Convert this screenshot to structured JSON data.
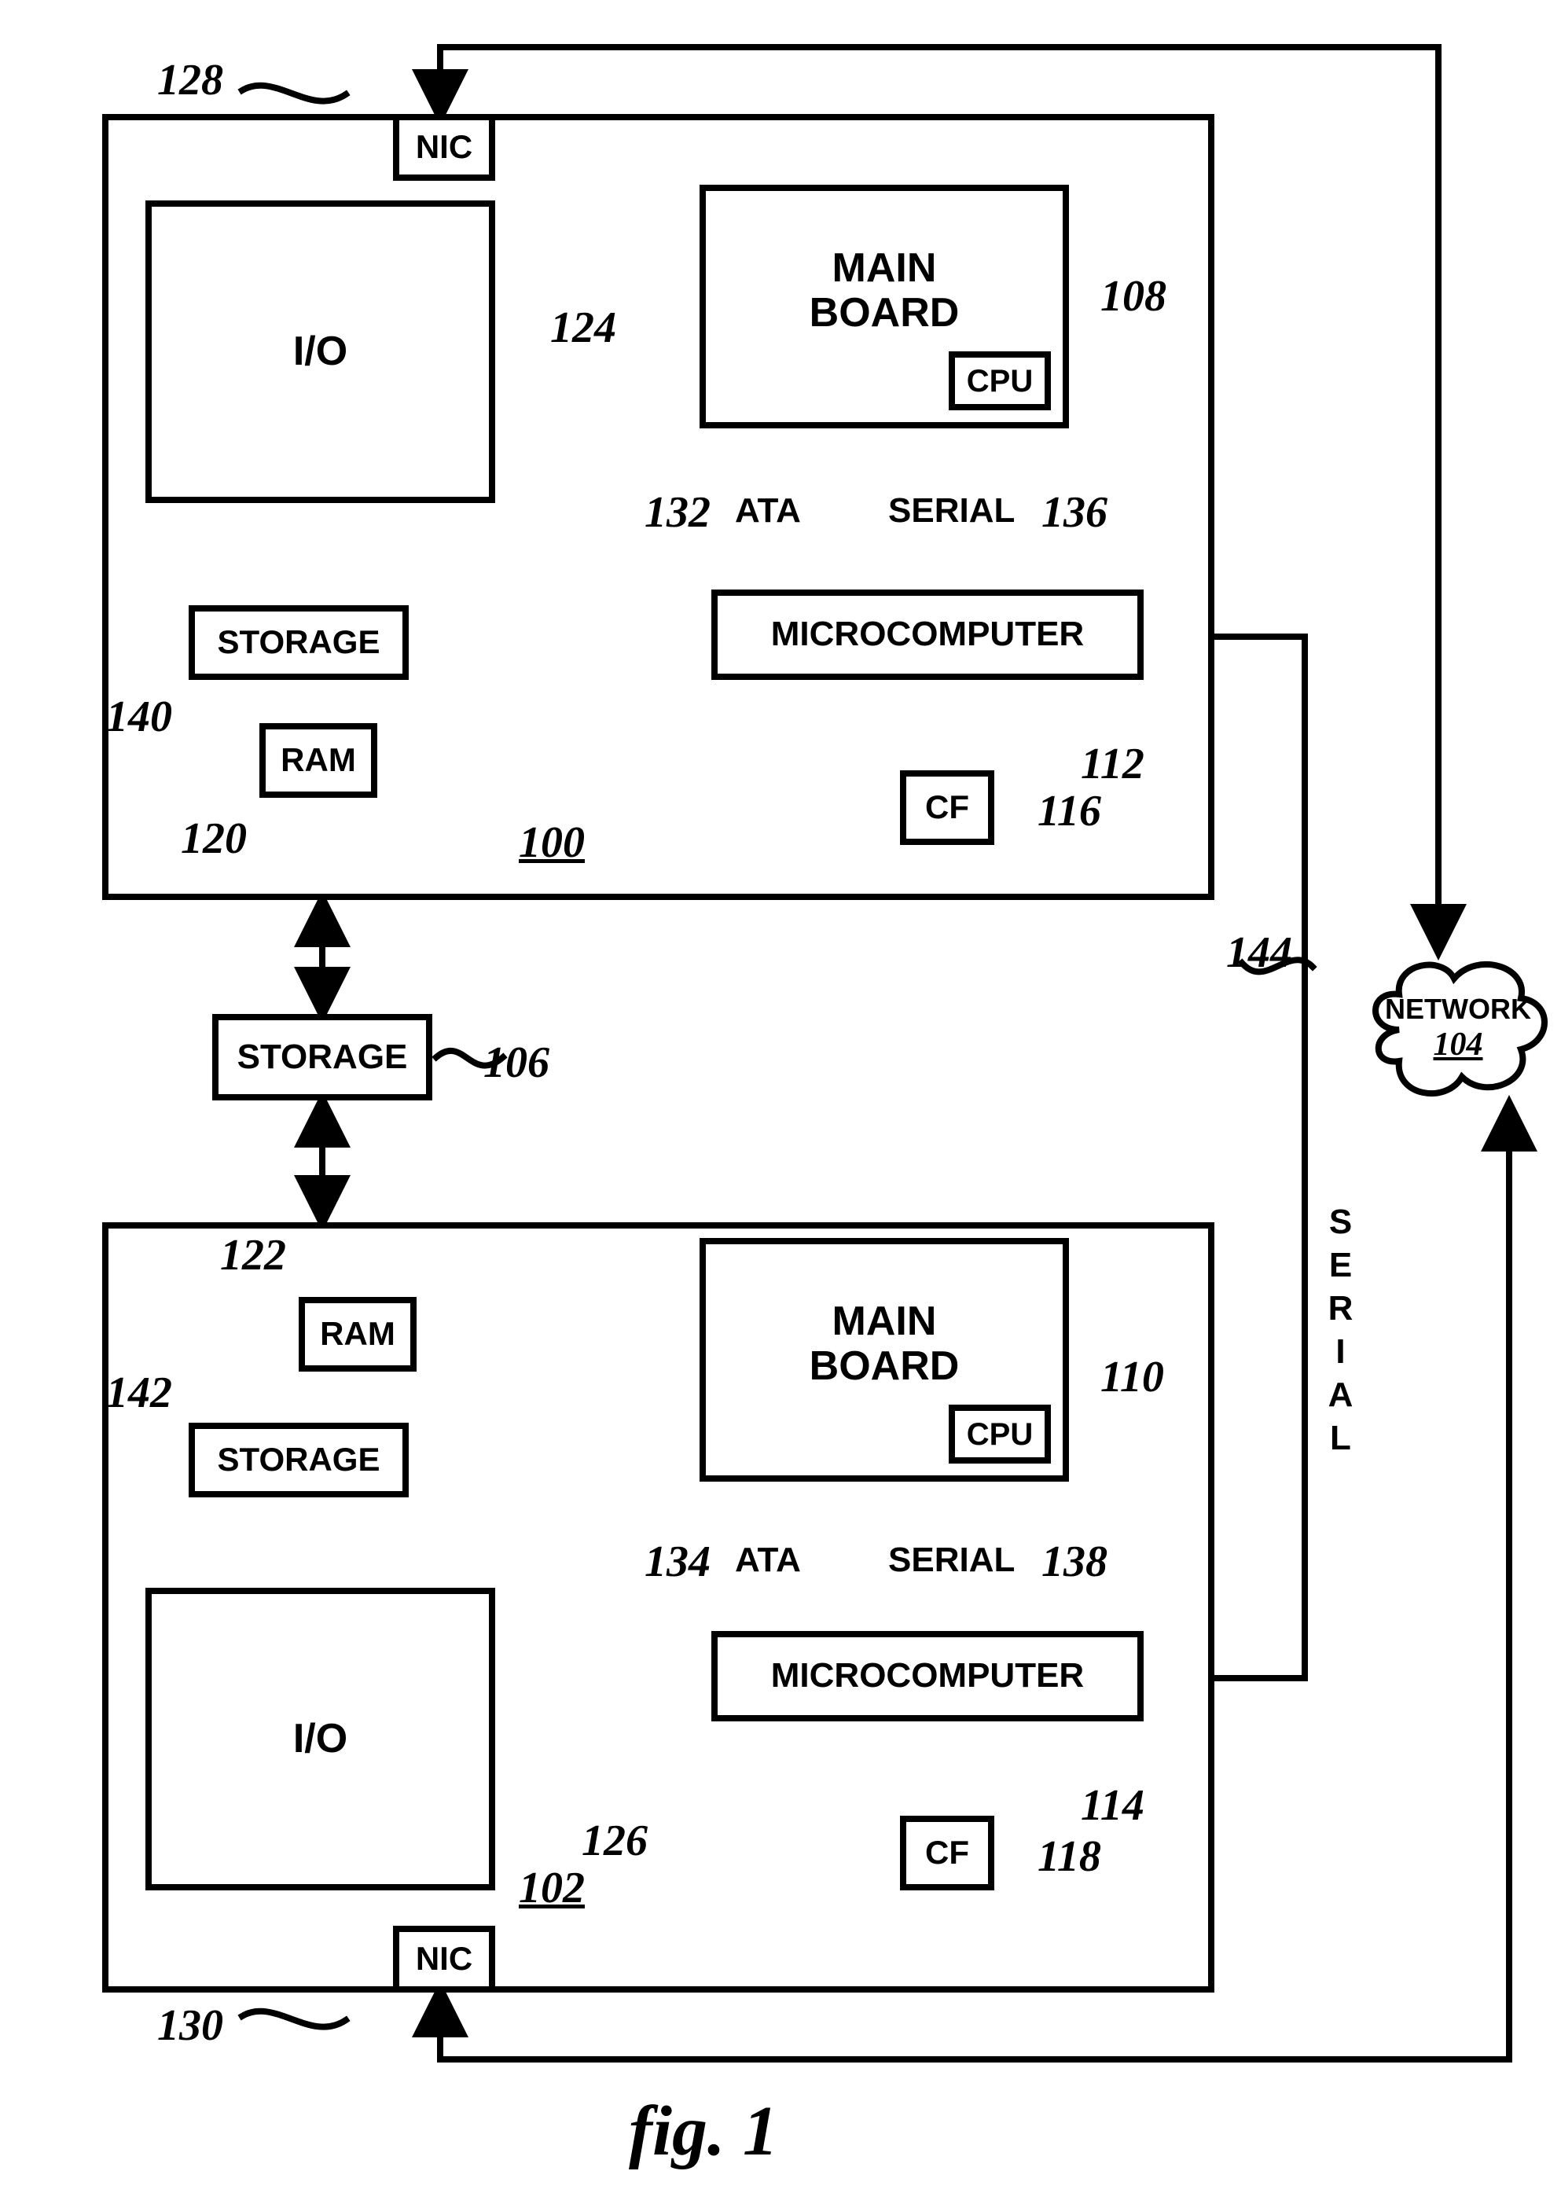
{
  "figure_caption": "fig. 1",
  "network_label": "NETWORK",
  "network_ref": "104",
  "shared_storage": {
    "label": "STORAGE",
    "ref": "106"
  },
  "serial_vertical_label": "SERIAL",
  "serial_ref": "144",
  "unit_top": {
    "id_ref": "100",
    "io": {
      "label": "I/O"
    },
    "nic": {
      "label": "NIC",
      "ref": "128"
    },
    "storage": {
      "label": "STORAGE",
      "ref": "140"
    },
    "ram": {
      "label": "RAM",
      "ref": "120"
    },
    "mainboard": {
      "label": "MAIN\nBOARD",
      "ref": "108",
      "cpu_label": "CPU"
    },
    "micro": {
      "label": "MICROCOMPUTER",
      "ref": "112"
    },
    "cf": {
      "label": "CF",
      "ref": "116"
    },
    "ata": {
      "label": "ATA",
      "ref": "132"
    },
    "serial": {
      "label": "SERIAL",
      "ref": "136"
    },
    "io_link_ref": "124"
  },
  "unit_bottom": {
    "id_ref": "102",
    "io": {
      "label": "I/O"
    },
    "nic": {
      "label": "NIC",
      "ref": "130"
    },
    "storage": {
      "label": "STORAGE",
      "ref": "142"
    },
    "ram": {
      "label": "RAM",
      "ref": "122"
    },
    "mainboard": {
      "label": "MAIN\nBOARD",
      "ref": "110",
      "cpu_label": "CPU"
    },
    "micro": {
      "label": "MICROCOMPUTER",
      "ref": "114"
    },
    "cf": {
      "label": "CF",
      "ref": "118"
    },
    "ata": {
      "label": "ATA",
      "ref": "134"
    },
    "serial": {
      "label": "SERIAL",
      "ref": "138"
    },
    "io_link_ref": "126"
  }
}
